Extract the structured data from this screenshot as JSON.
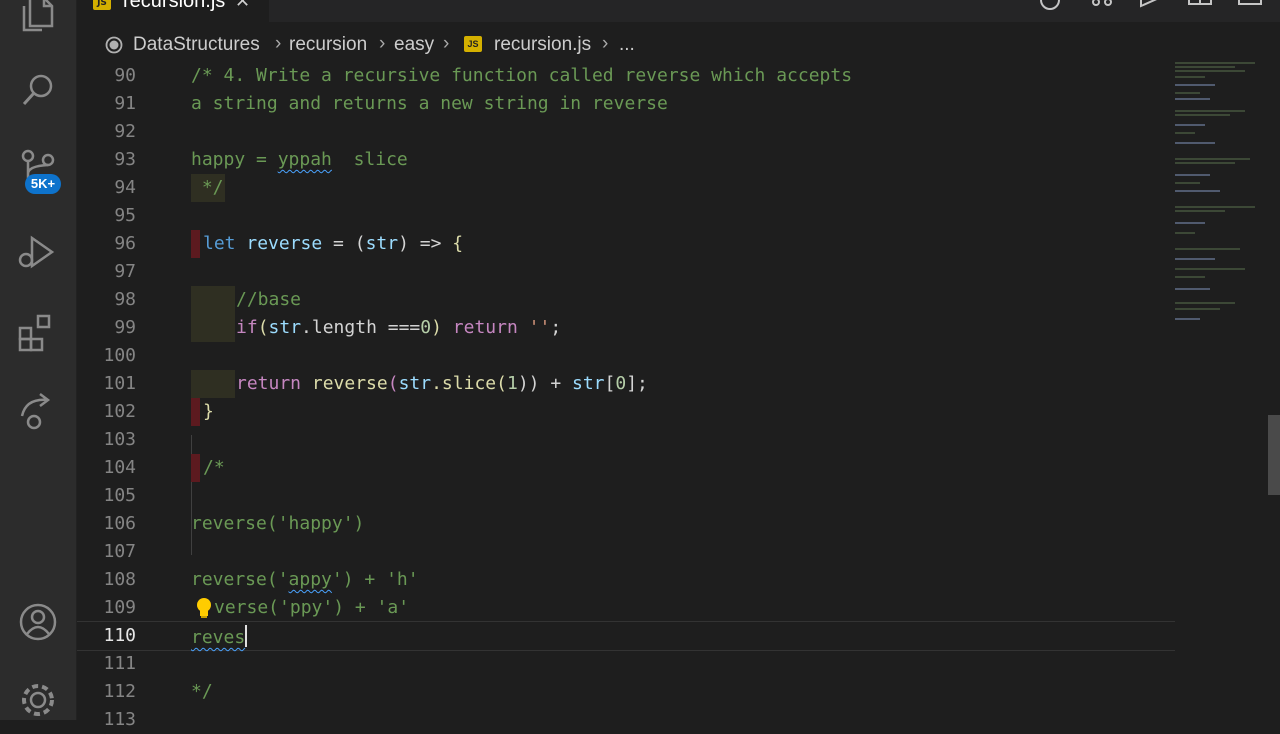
{
  "activity_bar": {
    "items": [
      {
        "name": "explorer-icon"
      },
      {
        "name": "search-icon"
      },
      {
        "name": "source-control-icon"
      },
      {
        "name": "run-debug-icon"
      },
      {
        "name": "extensions-icon"
      },
      {
        "name": "remote-explorer-icon"
      },
      {
        "name": "accounts-icon"
      },
      {
        "name": "settings-gear-icon"
      }
    ],
    "scm_badge": "5K+",
    "badge_color": "#0e73cc"
  },
  "tab": {
    "js_icon": "JS",
    "title": "recursion.js",
    "close": "✕"
  },
  "breadcrumbs": {
    "items": [
      "DataStructures",
      "recursion",
      "easy",
      "recursion.js",
      "..."
    ],
    "separator": "›",
    "js_icon": "JS"
  },
  "editor": {
    "lines": [
      {
        "n": "90"
      },
      {
        "n": "91"
      },
      {
        "n": "92"
      },
      {
        "n": "93"
      },
      {
        "n": "94"
      },
      {
        "n": "95"
      },
      {
        "n": "96"
      },
      {
        "n": "97"
      },
      {
        "n": "98"
      },
      {
        "n": "99"
      },
      {
        "n": "100"
      },
      {
        "n": "101"
      },
      {
        "n": "102"
      },
      {
        "n": "103"
      },
      {
        "n": "104"
      },
      {
        "n": "105"
      },
      {
        "n": "106"
      },
      {
        "n": "107"
      },
      {
        "n": "108"
      },
      {
        "n": "109"
      },
      {
        "n": "110"
      },
      {
        "n": "111"
      },
      {
        "n": "112"
      },
      {
        "n": "113"
      }
    ],
    "current_line": "110",
    "code": {
      "l90": "/* 4. Write a recursive function called reverse which accepts",
      "l91": "a string and returns a new string in reverse",
      "l93_a": "happy = ",
      "l93_b": "yppah",
      "l93_c": "  slice",
      "l94": " */",
      "l96_let": "let",
      "l96_name": "reverse",
      "l96_eq": " = (",
      "l96_param": "str",
      "l96_arrow": ") => ",
      "l96_brace": "{",
      "l98": "//base",
      "l99_if": "if",
      "l99_open": "(",
      "l99_str": "str",
      "l99_len": ".length ===",
      "l99_zero": "0",
      "l99_close": ") ",
      "l99_ret": "return",
      "l99_empty": " ''",
      "l99_semi": ";",
      "l101_ret": "return",
      "l101_fn": "reverse",
      "l101_a": "(",
      "l101_str": "str",
      "l101_slice": ".slice",
      "l101_b": "(",
      "l101_one": "1",
      "l101_c": ")) + ",
      "l101_str2": "str",
      "l101_d": "[",
      "l101_zero": "0",
      "l101_e": "];",
      "l102": "}",
      "l104": "/*",
      "l106": "reverse('happy')",
      "l108_a": "reverse('",
      "l108_b": "appy",
      "l108_c": "') + 'h'",
      "l109": "verse('ppy') + 'a'",
      "l110": "reves",
      "l112": "*/"
    }
  }
}
